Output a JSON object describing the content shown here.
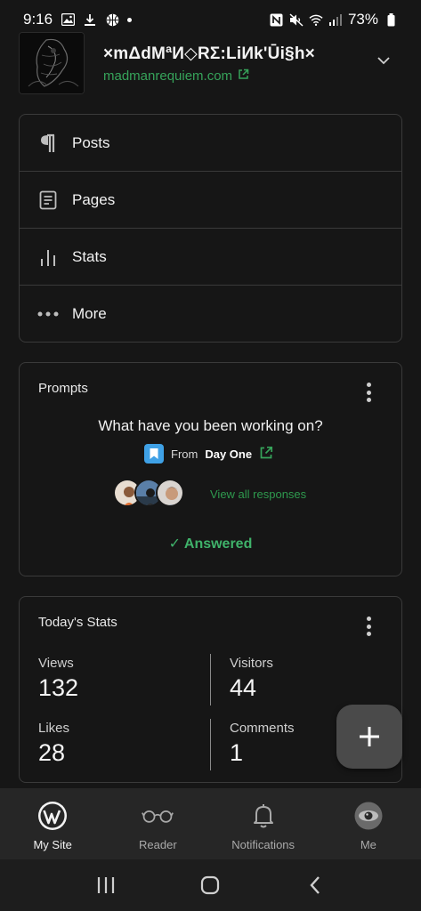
{
  "status_bar": {
    "time": "9:16",
    "battery": "73%"
  },
  "site": {
    "title": "×mΔdMªИ◇RΣ:LiИk'Ūi§h×",
    "url": "madmanrequiem.com"
  },
  "menu": {
    "items": [
      {
        "label": "Posts",
        "icon": "pilcrow-icon"
      },
      {
        "label": "Pages",
        "icon": "page-icon"
      },
      {
        "label": "Stats",
        "icon": "stats-bars-icon"
      },
      {
        "label": "More",
        "icon": "ellipsis-icon"
      }
    ]
  },
  "prompts": {
    "title": "Prompts",
    "question": "What have you been working on?",
    "source_from": "From",
    "source_name": "Day One",
    "view_all": "View all responses",
    "answered": "✓ Answered"
  },
  "stats": {
    "title": "Today's Stats",
    "views_label": "Views",
    "views_value": "132",
    "visitors_label": "Visitors",
    "visitors_value": "44",
    "likes_label": "Likes",
    "likes_value": "28",
    "comments_label": "Comments",
    "comments_value": "1"
  },
  "bottom_nav": {
    "items": [
      {
        "label": "My Site",
        "icon": "wordpress-icon",
        "active": true
      },
      {
        "label": "Reader",
        "icon": "glasses-icon",
        "active": false
      },
      {
        "label": "Notifications",
        "icon": "bell-icon",
        "active": false
      },
      {
        "label": "Me",
        "icon": "avatar-icon",
        "active": false
      }
    ]
  },
  "colors": {
    "accent_green": "#36a35a",
    "background": "#161616",
    "card_border": "#3a3a3a",
    "dayone_blue": "#3fa1e6"
  }
}
